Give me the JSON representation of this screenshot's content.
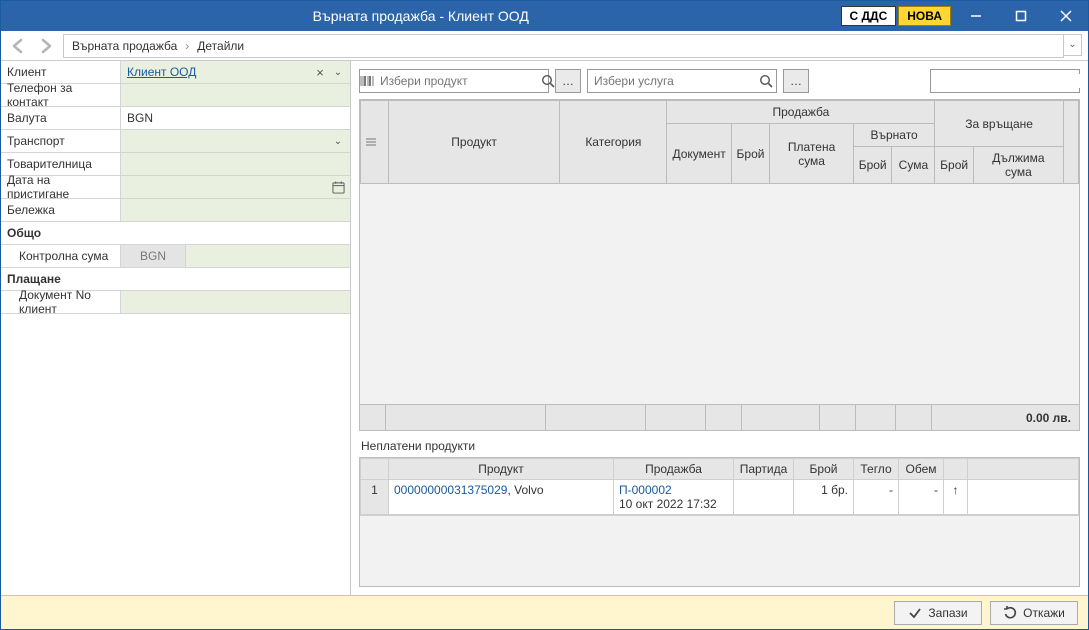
{
  "titlebar": {
    "title": "Върната продажба - Клиент ООД",
    "badge_vat": "С ДДС",
    "badge_new": "НОВА"
  },
  "breadcrumb": {
    "item1": "Върната продажба",
    "item2": "Детайли"
  },
  "left_form": {
    "client_label": "Клиент",
    "client_value": "Клиент ООД",
    "phone_label": "Телефон за контакт",
    "phone_value": "",
    "currency_label": "Валута",
    "currency_value": "BGN",
    "transport_label": "Транспорт",
    "transport_value": "",
    "waybill_label": "Товарителница",
    "waybill_value": "",
    "arrival_label": "Дата на пристигане",
    "arrival_value": "",
    "note_label": "Бележка",
    "note_value": "",
    "section_total": "Общо",
    "ctrl_sum_label": "Контролна сума",
    "ctrl_sum_currency": "BGN",
    "section_payment": "Плащане",
    "doc_no_label": "Документ No клиент",
    "doc_no_value": ""
  },
  "search": {
    "product_placeholder": "Избери продукт",
    "service_placeholder": "Избери услуга",
    "free_placeholder": ""
  },
  "upper_grid": {
    "col_product": "Продукт",
    "col_category": "Категория",
    "grp_sale": "Продажба",
    "grp_return": "За връщане",
    "col_document": "Документ",
    "col_qty": "Брой",
    "col_paid_amount": "Платена сума",
    "grp_returned": "Върнато",
    "col_ret_qty": "Брой",
    "col_ret_sum": "Сума",
    "col_to_ret_qty": "Брой",
    "col_due_amount": "Дължима сума",
    "total": "0.00 лв."
  },
  "lower": {
    "heading": "Неплатени продукти",
    "col_product": "Продукт",
    "col_sale": "Продажба",
    "col_lot": "Партида",
    "col_qty": "Брой",
    "col_weight": "Тегло",
    "col_volume": "Обем",
    "rows": [
      {
        "rownum": "1",
        "product_code": "00000000031375029",
        "product_name": ", Volvo",
        "sale_doc": "П-000002",
        "sale_date": "10 окт 2022 17:32",
        "lot": "",
        "qty": "1 бр.",
        "weight": "-",
        "volume": "-"
      }
    ]
  },
  "actions": {
    "save": "Запази",
    "cancel": "Откажи"
  }
}
